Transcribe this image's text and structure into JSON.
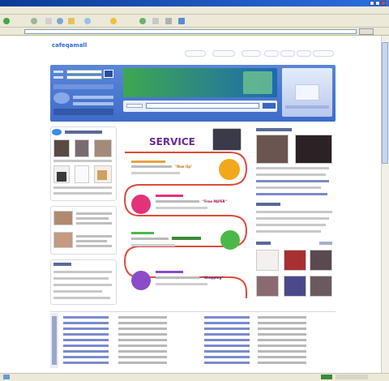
{
  "window": {
    "title": "",
    "menu": [
      "",
      "",
      "",
      "",
      "",
      ""
    ],
    "toolbar": {
      "back": "",
      "forward": ""
    },
    "address": {
      "value": "",
      "go_label": ""
    }
  },
  "site": {
    "logo": "cafeqamall",
    "logo_sub": "",
    "topnav": [
      "",
      "",
      "",
      "",
      "",
      "",
      ""
    ]
  },
  "banner": {
    "promo_title": "",
    "promo_sub": ""
  },
  "service": {
    "title": "SERVICE",
    "items": [
      {
        "emphasis": "\"Rise Up\"",
        "color": "#f2a81a"
      },
      {
        "emphasis": "\"Free PAPER\"",
        "color": "#e2337a"
      },
      {
        "emphasis": "",
        "color": "#4cb84a"
      },
      {
        "emphasis": "\"Shopping\"",
        "color": "#8a4cc8"
      }
    ]
  },
  "colors": {
    "accent": "#2c6ad6",
    "banner": "#4a78d0",
    "service_title": "#6a2a9a"
  }
}
